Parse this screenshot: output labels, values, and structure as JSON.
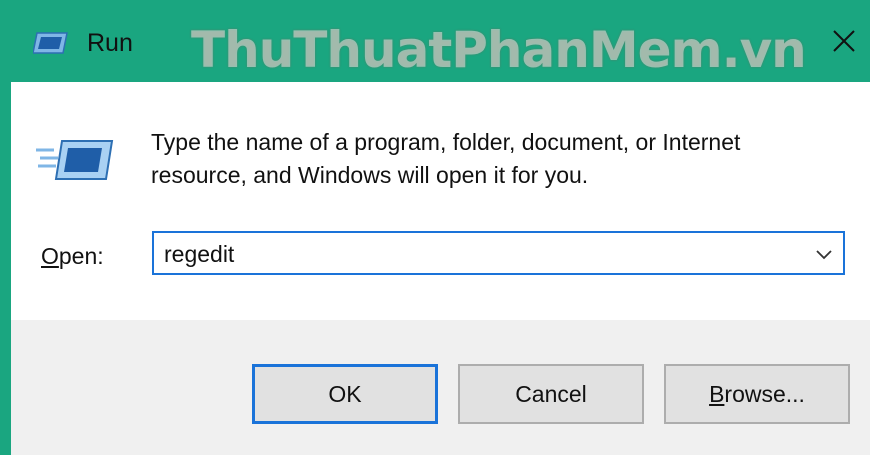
{
  "window": {
    "title": "Run",
    "watermark": "ThuThuatPhanMem.vn",
    "close_glyph": "✕",
    "accent_color": "#1aa680"
  },
  "content": {
    "description_line1": "Type the name of a program, folder, document, or Internet",
    "description_line2": "resource, and Windows will open it for you.",
    "open_label_prefix": "O",
    "open_label_rest": "pen:",
    "open_value": "regedit",
    "icons": [
      "run-app-icon",
      "run-large-icon",
      "dropdown-chevron-icon",
      "close-icon"
    ]
  },
  "buttons": {
    "ok": "OK",
    "cancel": "Cancel",
    "browse_prefix": "B",
    "browse_rest": "rowse..."
  }
}
